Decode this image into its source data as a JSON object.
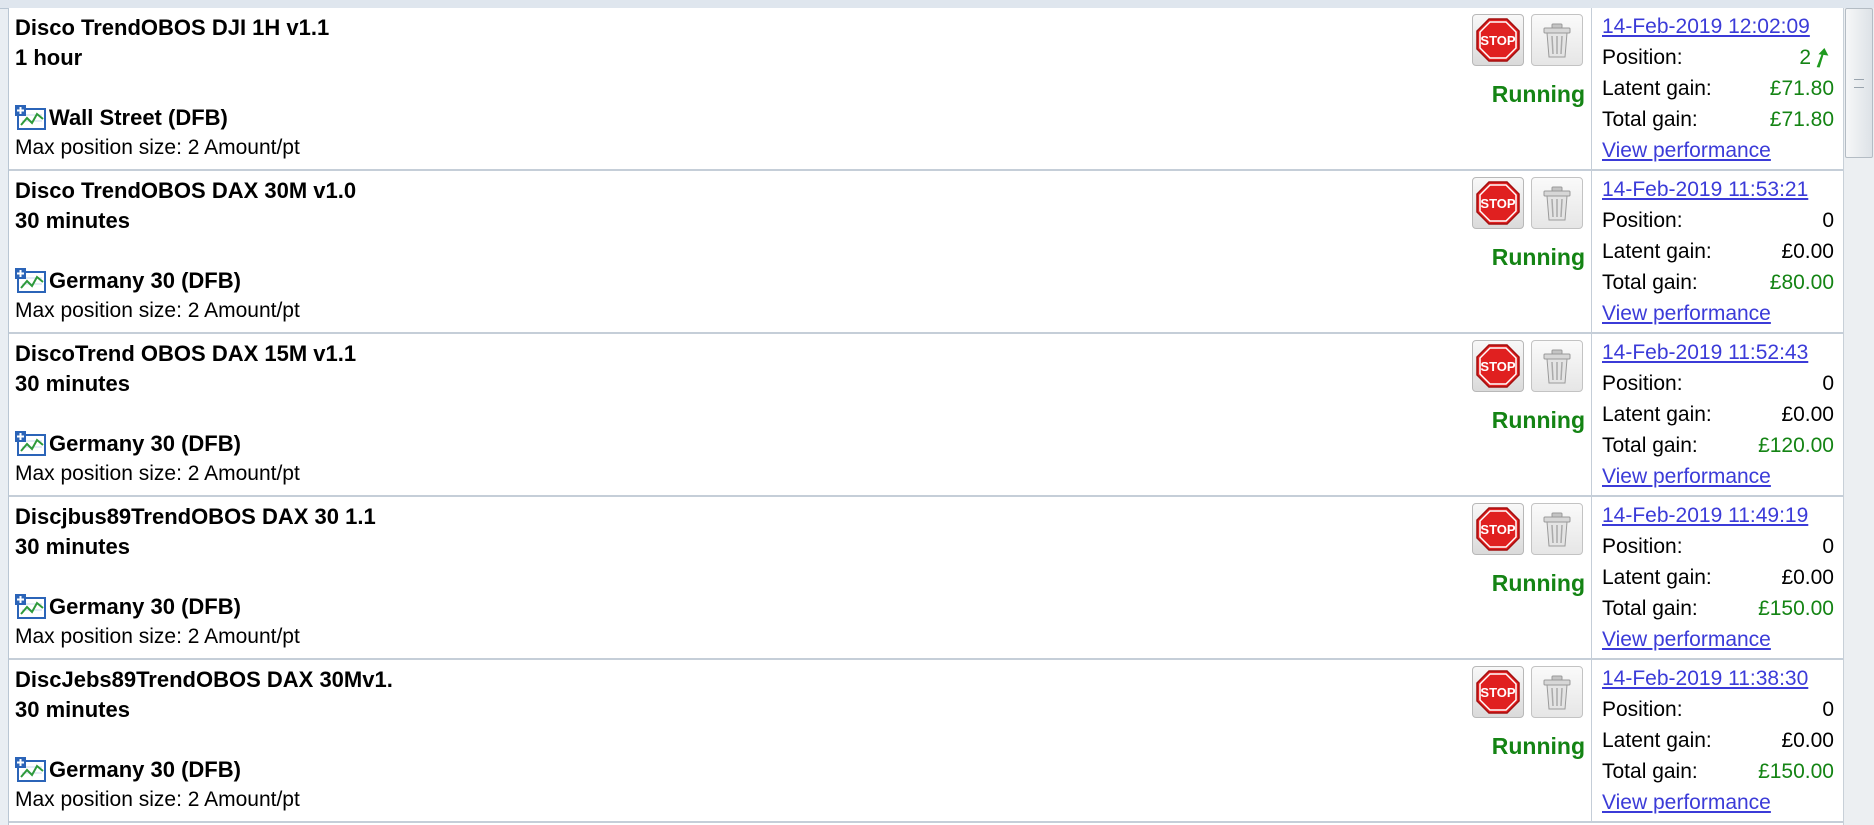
{
  "ui": {
    "stop_label": "STOP",
    "position_label": "Position:",
    "latent_label": "Latent gain:",
    "total_label": "Total gain:",
    "performance_link": "View performance",
    "status_color": "#148414",
    "link_color": "#3b3bd8",
    "stop_icon_color": "#e02020"
  },
  "strategies": [
    {
      "name": "Disco TrendOBOS DJI 1H v1.1",
      "timeframe": "1 hour",
      "market": "Wall Street (DFB)",
      "max_position": "Max position size: 2 Amount/pt",
      "status": "Running",
      "date": "14-Feb-2019 12:02:09",
      "position": "2",
      "position_direction": "long-up-arrow",
      "latent_gain": "£71.80",
      "latent_positive": true,
      "total_gain": "£71.80"
    },
    {
      "name": "Disco TrendOBOS DAX 30M v1.0",
      "timeframe": "30 minutes",
      "market": "Germany 30 (DFB)",
      "max_position": "Max position size: 2 Amount/pt",
      "status": "Running",
      "date": "14-Feb-2019 11:53:21",
      "position": "0",
      "position_direction": "",
      "latent_gain": "£0.00",
      "latent_positive": false,
      "total_gain": "£80.00"
    },
    {
      "name": "DiscoTrend OBOS DAX 15M v1.1",
      "timeframe": "30 minutes",
      "market": "Germany 30 (DFB)",
      "max_position": "Max position size: 2 Amount/pt",
      "status": "Running",
      "date": "14-Feb-2019 11:52:43",
      "position": "0",
      "position_direction": "",
      "latent_gain": "£0.00",
      "latent_positive": false,
      "total_gain": "£120.00"
    },
    {
      "name": "Discjbus89TrendOBOS DAX 30 1.1",
      "timeframe": "30 minutes",
      "market": "Germany 30 (DFB)",
      "max_position": "Max position size: 2 Amount/pt",
      "status": "Running",
      "date": "14-Feb-2019 11:49:19",
      "position": "0",
      "position_direction": "",
      "latent_gain": "£0.00",
      "latent_positive": false,
      "total_gain": "£150.00"
    },
    {
      "name": "DiscJebs89TrendOBOS DAX 30Mv1.",
      "timeframe": "30 minutes",
      "market": "Germany 30 (DFB)",
      "max_position": "Max position size: 2 Amount/pt",
      "status": "Running",
      "date": "14-Feb-2019 11:38:30",
      "position": "0",
      "position_direction": "",
      "latent_gain": "£0.00",
      "latent_positive": false,
      "total_gain": "£150.00"
    }
  ]
}
